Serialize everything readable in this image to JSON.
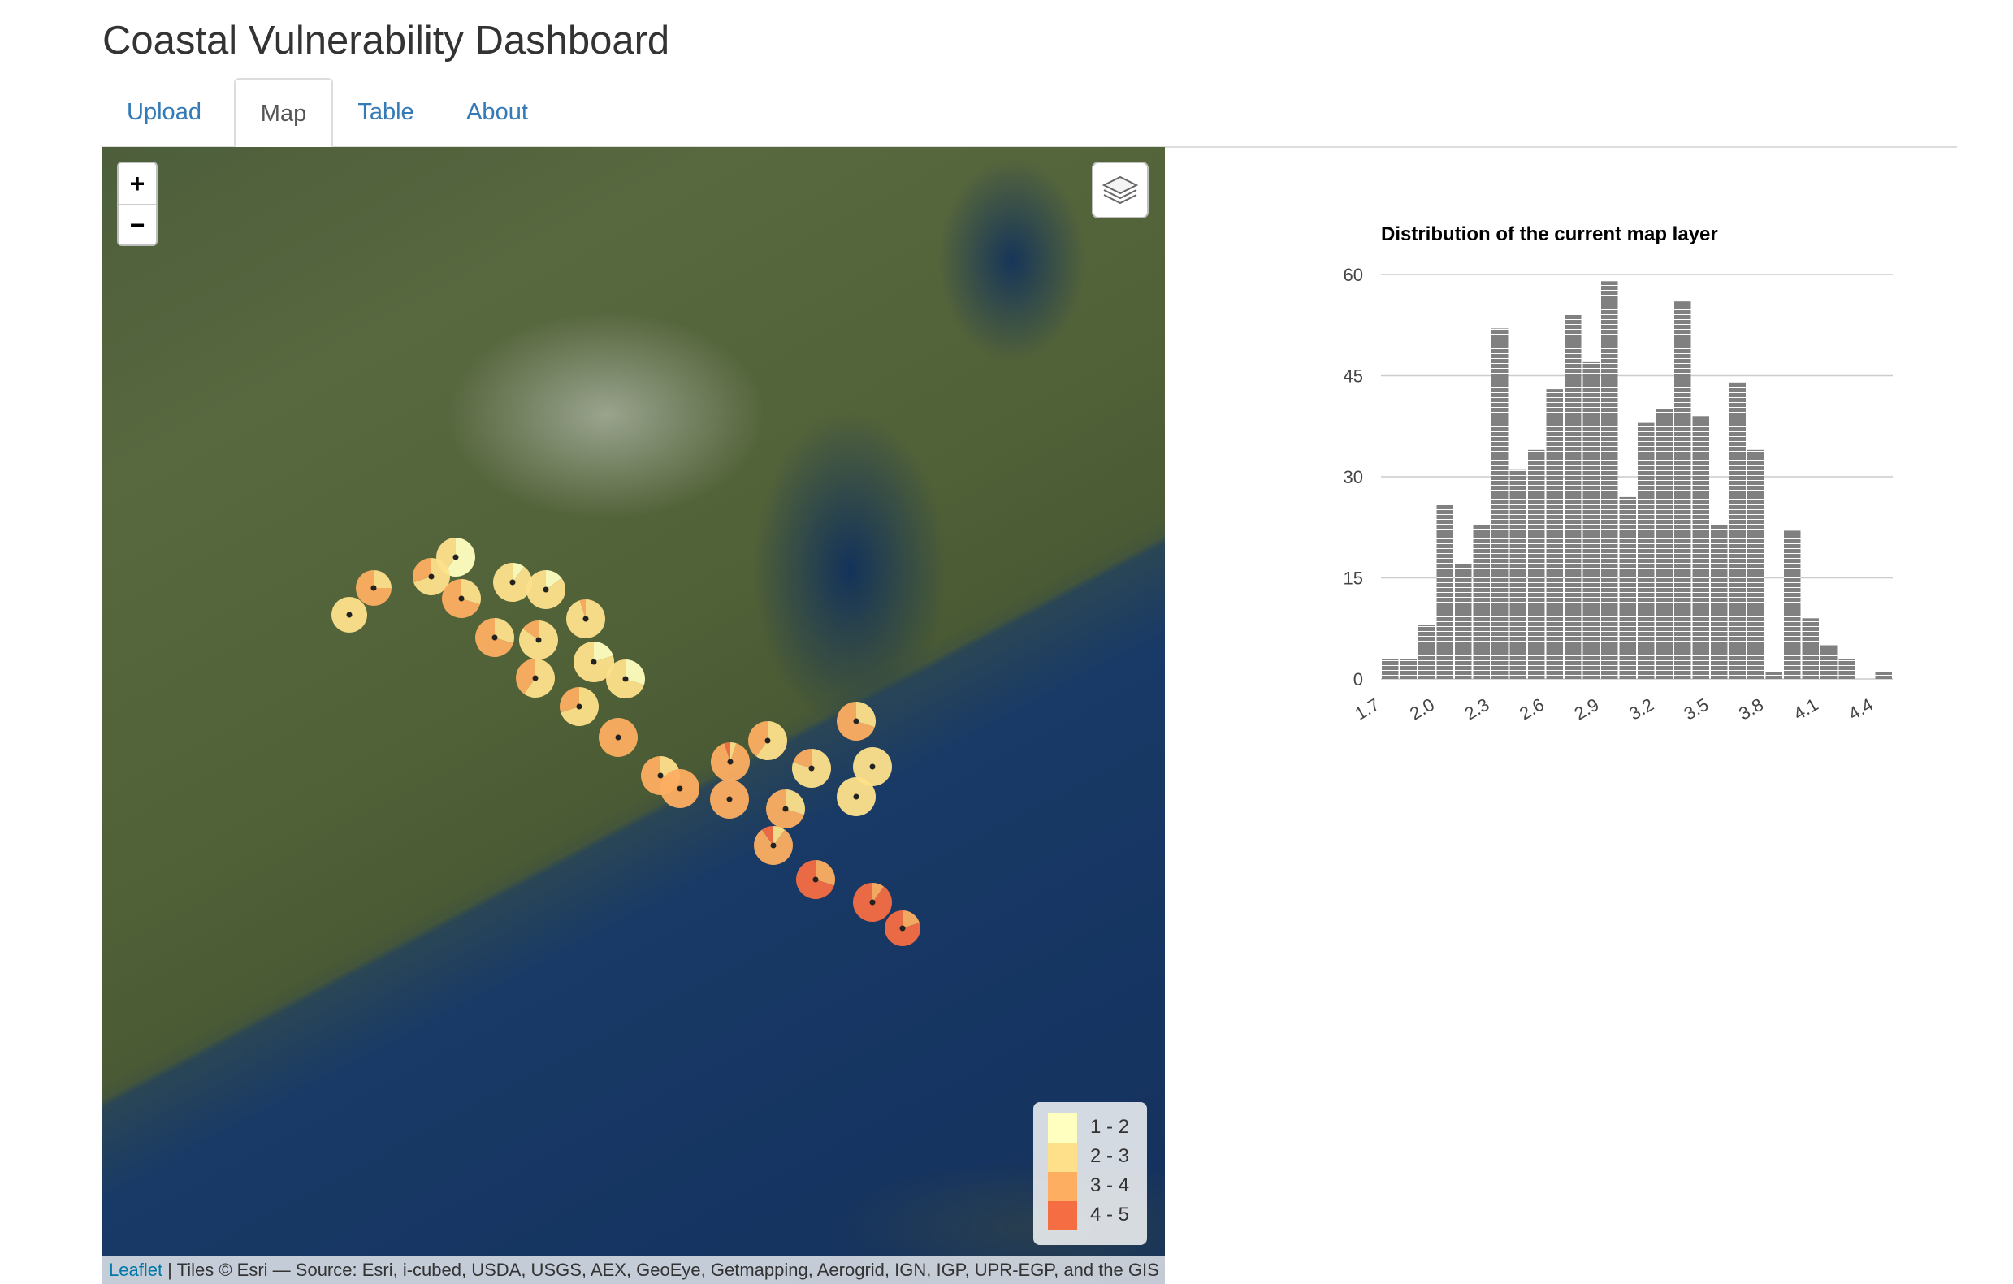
{
  "header": {
    "title": "Coastal Vulnerability Dashboard"
  },
  "tabs": [
    {
      "label": "Upload",
      "active": false
    },
    {
      "label": "Map",
      "active": true
    },
    {
      "label": "Table",
      "active": false
    },
    {
      "label": "About",
      "active": false
    }
  ],
  "map": {
    "zoom_in": "+",
    "zoom_out": "−",
    "layers_icon": "layers-icon",
    "legend": [
      {
        "label": "1 - 2",
        "color": "#ffffbf"
      },
      {
        "label": "2 - 3",
        "color": "#fee08b"
      },
      {
        "label": "3 - 4",
        "color": "#fdae61"
      },
      {
        "label": "4 - 5",
        "color": "#f46d43"
      }
    ],
    "attribution_link": "Leaflet",
    "attribution_text": " | Tiles © Esri — Source: Esri, i-cubed, USDA, USGS, AEX, GeoEye, Getmapping, Aerogrid, IGN, IGP, UPR-EGP, and the GIS"
  },
  "chart_data": {
    "type": "bar",
    "title": "Distribution of the current map layer",
    "xlabel": "",
    "ylabel": "",
    "x_ticks": [
      "1.7",
      "2.0",
      "2.3",
      "2.6",
      "2.9",
      "3.2",
      "3.5",
      "3.8",
      "4.1",
      "4.4"
    ],
    "y_ticks": [
      0,
      15,
      30,
      45,
      60
    ],
    "ylim": [
      0,
      60
    ],
    "xlim": [
      1.7,
      4.5
    ],
    "bin_width": 0.1,
    "bin_starts": [
      1.7,
      1.8,
      1.9,
      2.0,
      2.1,
      2.2,
      2.3,
      2.4,
      2.5,
      2.6,
      2.7,
      2.8,
      2.9,
      3.0,
      3.1,
      3.2,
      3.3,
      3.4,
      3.5,
      3.6,
      3.7,
      3.8,
      3.9,
      4.0,
      4.1,
      4.2,
      4.3,
      4.4
    ],
    "values": [
      3,
      3,
      8,
      26,
      17,
      23,
      52,
      31,
      34,
      43,
      54,
      47,
      59,
      27,
      38,
      40,
      56,
      39,
      23,
      44,
      34,
      1,
      22,
      9,
      5,
      3,
      0,
      1
    ],
    "bar_color": "#808080",
    "grid": true
  }
}
